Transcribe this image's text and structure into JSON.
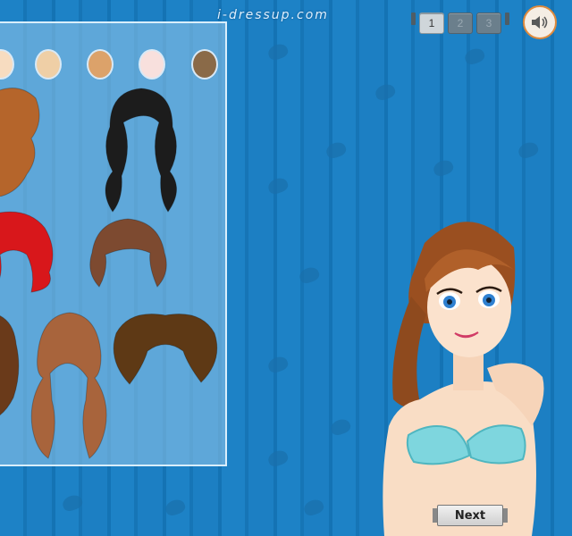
{
  "site": {
    "title": "i-dressup.com"
  },
  "pagination": {
    "pages": [
      "1",
      "2",
      "3"
    ],
    "active_page": "1"
  },
  "sound": {
    "icon": "speaker-icon"
  },
  "skin_tones": [
    "#f7dcc0",
    "#efcfa6",
    "#dca26a",
    "#f8e0dd",
    "#8a6a48"
  ],
  "hair_styles": [
    {
      "name": "auburn-wavy",
      "color": "#b5652b"
    },
    {
      "name": "black-long-wavy",
      "color": "#1c1c1c"
    },
    {
      "name": "red-bob",
      "color": "#d8171b"
    },
    {
      "name": "brown-bob-bangs",
      "color": "#7d4a30"
    },
    {
      "name": "dark-brown-curly",
      "color": "#6a3a1a"
    },
    {
      "name": "brown-pigtails",
      "color": "#a8643c"
    },
    {
      "name": "brown-afro",
      "color": "#5e3915"
    }
  ],
  "next_button": {
    "label": "Next"
  }
}
